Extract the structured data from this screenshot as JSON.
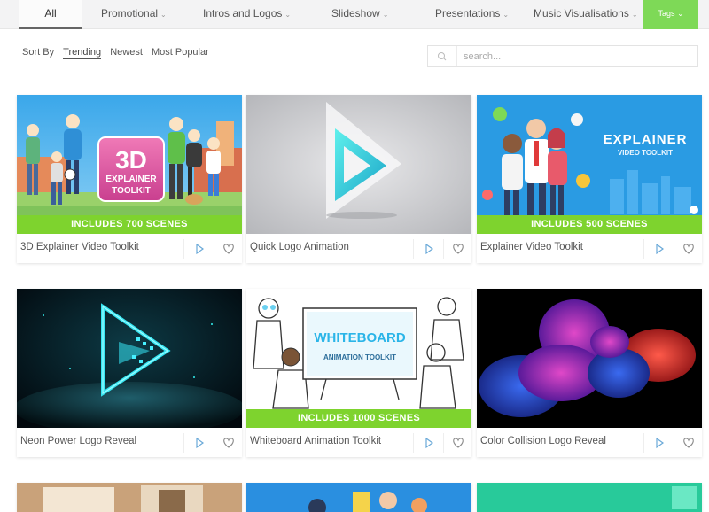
{
  "nav": {
    "items": [
      {
        "label": "All"
      },
      {
        "label": "Promotional"
      },
      {
        "label": "Intros and Logos"
      },
      {
        "label": "Slideshow"
      },
      {
        "label": "Presentations"
      },
      {
        "label": "Music Visualisations"
      }
    ],
    "tags_label": "Tags",
    "active_color": "#7ed957"
  },
  "sort": {
    "label": "Sort By",
    "options": [
      "Trending",
      "Newest",
      "Most Popular"
    ],
    "active": "Trending"
  },
  "search": {
    "placeholder": "search..."
  },
  "cards": [
    {
      "title": "3D Explainer Video Toolkit",
      "banner": "INCLUDES 700 SCENES",
      "thumb_text_1": "3D",
      "thumb_text_2": "EXPLAINER",
      "thumb_text_3": "TOOLKIT"
    },
    {
      "title": "Quick Logo Animation"
    },
    {
      "title": "Explainer Video Toolkit",
      "banner": "INCLUDES 500 SCENES",
      "thumb_text_1": "EXPLAINER",
      "thumb_text_2": "VIDEO TOOLKIT"
    },
    {
      "title": "Neon Power Logo Reveal"
    },
    {
      "title": "Whiteboard Animation Toolkit",
      "banner": "INCLUDES 1000 SCENES",
      "thumb_text_1": "WHITEBOARD",
      "thumb_text_2": "ANIMATION TOOLKIT"
    },
    {
      "title": "Color Collision Logo Reveal"
    }
  ],
  "colors": {
    "banner_green": "#7ed32e",
    "brand_teal": "#27c4d9"
  }
}
